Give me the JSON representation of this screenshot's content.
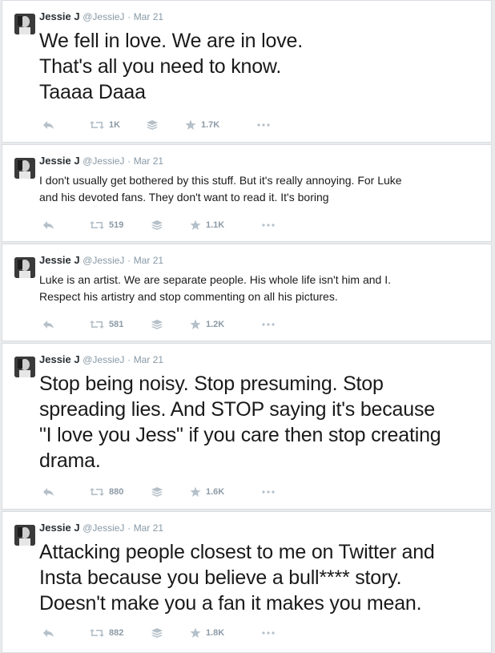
{
  "tweets": [
    {
      "name": "Jessie J",
      "handle": "@JessieJ",
      "sep": "·",
      "date": "Mar 21",
      "lines": [
        "We fell in love. We are in love.",
        "That's all you need to know.",
        "Taaaa Daaa"
      ],
      "retweets": "1K",
      "favorites": "1.7K"
    },
    {
      "name": "Jessie J",
      "handle": "@JessieJ",
      "sep": "·",
      "date": "Mar 21",
      "lines": [
        "I don't usually get bothered by this stuff. But it's really annoying. For Luke",
        "and his devoted fans. They don't want to read it. It's boring"
      ],
      "retweets": "519",
      "favorites": "1.1K"
    },
    {
      "name": "Jessie J",
      "handle": "@JessieJ",
      "sep": "·",
      "date": "Mar 21",
      "lines": [
        "Luke is an artist. We are separate people. His whole life isn't him and I.",
        "Respect his artistry and stop commenting on all his pictures."
      ],
      "retweets": "581",
      "favorites": "1.2K"
    },
    {
      "name": "Jessie J",
      "handle": "@JessieJ",
      "sep": "·",
      "date": "Mar 21",
      "lines": [
        "Stop being noisy. Stop presuming. Stop",
        "spreading lies. And STOP saying it's because",
        "\"I love you Jess\" if you care then stop creating",
        "drama."
      ],
      "retweets": "880",
      "favorites": "1.6K"
    },
    {
      "name": "Jessie J",
      "handle": "@JessieJ",
      "sep": "·",
      "date": "Mar 21",
      "lines": [
        "Attacking people closest to me on Twitter and",
        "Insta because you believe a bull**** story.",
        "Doesn't make you a fan it makes you mean."
      ],
      "retweets": "882",
      "favorites": "1.8K"
    }
  ],
  "icons": {
    "reply": "reply-icon",
    "retweet": "retweet-icon",
    "buffer": "buffer-icon",
    "favorite": "star-icon",
    "more": "more-icon"
  },
  "colors": {
    "action_icon": "#b5c0c9",
    "meta_text": "#8899a6",
    "name_text": "#292f33"
  }
}
